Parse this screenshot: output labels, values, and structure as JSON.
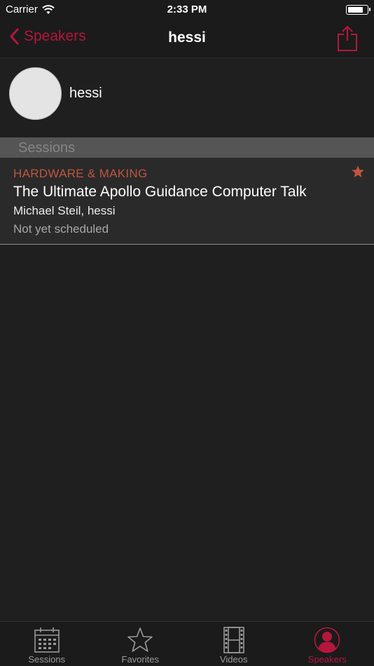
{
  "status_bar": {
    "carrier": "Carrier",
    "time": "2:33 PM",
    "battery_level": 0.85
  },
  "nav": {
    "back_label": "Speakers",
    "title": "hessi",
    "share_icon": "share-icon"
  },
  "speaker": {
    "name": "hessi"
  },
  "sessions_section": {
    "header": "Sessions",
    "items": [
      {
        "track": "HARDWARE & MAKING",
        "title": "The Ultimate Apollo Guidance Computer Talk",
        "speakers": "Michael Steil, hessi",
        "status": "Not yet scheduled",
        "favorited": true
      }
    ]
  },
  "tab_bar": {
    "tabs": [
      {
        "label": "Sessions",
        "icon": "calendar-icon",
        "active": false
      },
      {
        "label": "Favorites",
        "icon": "star-icon",
        "active": false
      },
      {
        "label": "Videos",
        "icon": "film-icon",
        "active": false
      },
      {
        "label": "Speakers",
        "icon": "person-icon",
        "active": true
      }
    ]
  },
  "colors": {
    "accent": "#b5173c",
    "track": "#c0553f",
    "background": "#1f1f1f",
    "bar": "#1b1b1b"
  }
}
